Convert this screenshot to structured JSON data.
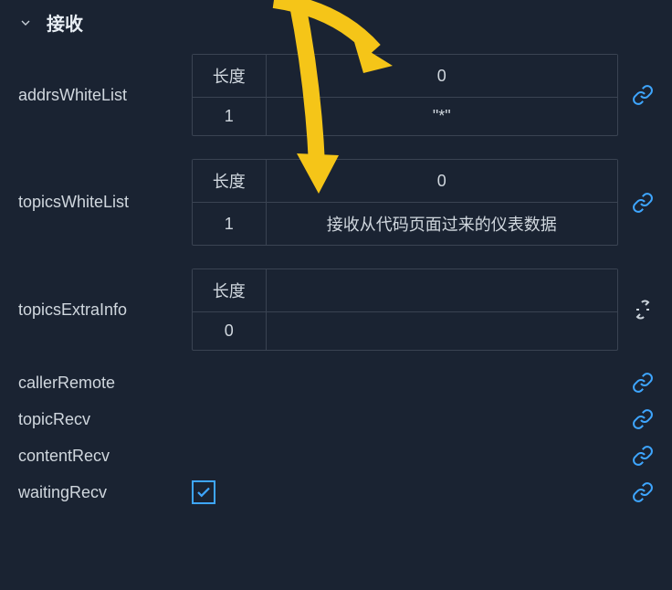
{
  "section": {
    "title": "接收"
  },
  "properties": {
    "addrsWhiteList": {
      "label": "addrsWhiteList",
      "lengthLabel": "长度",
      "lengthValue": "1",
      "colHeader": "0",
      "rowValue": "\"*\"",
      "linked": true
    },
    "topicsWhiteList": {
      "label": "topicsWhiteList",
      "lengthLabel": "长度",
      "lengthValue": "1",
      "colHeader": "0",
      "rowValue": "接收从代码页面过来的仪表数据",
      "linked": true
    },
    "topicsExtraInfo": {
      "label": "topicsExtraInfo",
      "lengthLabel": "长度",
      "lengthValue": "0",
      "linked": false
    },
    "callerRemote": {
      "label": "callerRemote",
      "linked": true
    },
    "topicRecv": {
      "label": "topicRecv",
      "linked": true
    },
    "contentRecv": {
      "label": "contentRecv",
      "linked": true
    },
    "waitingRecv": {
      "label": "waitingRecv",
      "checked": true,
      "linked": true
    }
  }
}
